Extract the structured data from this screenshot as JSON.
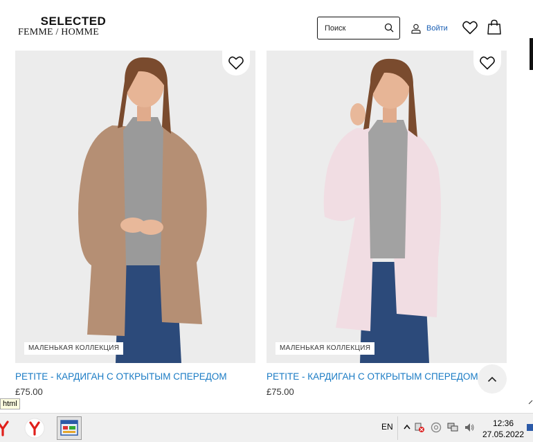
{
  "header": {
    "logo_top": "SELECTED",
    "logo_bottom": "FEMME / HOMME",
    "search_placeholder": "Поиск",
    "login_label": "Войти"
  },
  "products": [
    {
      "badge": "МАЛЕНЬКАЯ КОЛЛЕКЦИЯ",
      "title": "PETITE - КАРДИГАН С ОТКРЫТЫМ СПЕРЕДОМ",
      "price": "£75.00",
      "cardigan_color": "#b58f74"
    },
    {
      "badge": "МАЛЕНЬКАЯ КОЛЛЕКЦИЯ",
      "title": "PETITE - КАРДИГАН С ОТКРЫТЫМ СПЕРЕДОМ",
      "price": "£75.00",
      "cardigan_color": "#f1dde3"
    }
  ],
  "tooltip": "html",
  "taskbar": {
    "language": "EN",
    "time": "12:36",
    "date": "27.05.2022"
  },
  "colors": {
    "link": "#1a7bc4",
    "accent": "#1a5fb4",
    "photo_bg": "#ececec",
    "yandex_red": "#e0201b"
  }
}
